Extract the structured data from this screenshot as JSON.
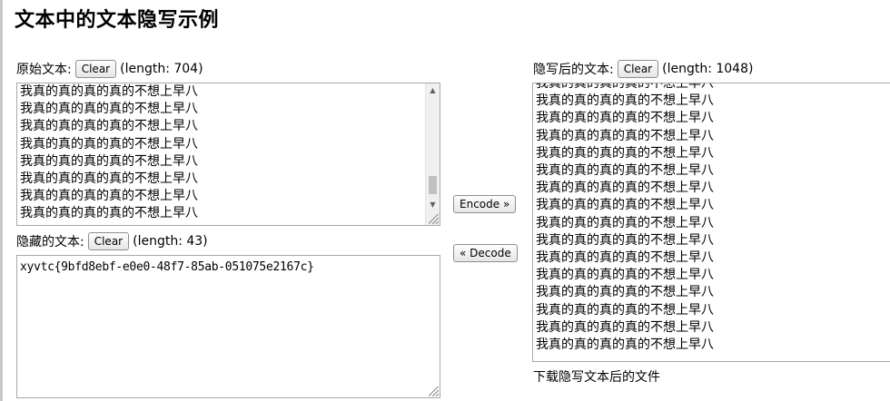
{
  "page": {
    "title": "文本中的文本隐写示例"
  },
  "original": {
    "label": "原始文本:",
    "clear_label": "Clear",
    "length_text": "(length: 704)",
    "lines": [
      "我真的真的真的真的不想上早八",
      "我真的真的真的真的不想上早八",
      "我真的真的真的真的不想上早八",
      "我真的真的真的真的不想上早八",
      "我真的真的真的真的不想上早八",
      "我真的真的真的真的不想上早八",
      "我真的真的真的真的不想上早八",
      "我真的真的真的真的不想上早八"
    ]
  },
  "hidden": {
    "label": "隐藏的文本:",
    "clear_label": "Clear",
    "length_text": "(length: 43)",
    "value": "xyvtc{9bfd8ebf-e0e0-48f7-85ab-051075e2167c}"
  },
  "actions": {
    "encode_label": "Encode »",
    "decode_label": "« Decode"
  },
  "stego": {
    "label": "隐写后的文本:",
    "clear_label": "Clear",
    "length_text": "(length: 1048)",
    "lines": [
      "我真的真的真的真的不想上早八",
      "我真的真的真的真的不想上早八",
      "我真的真的真的真的不想上早八",
      "我真的真的真的真的不想上早八",
      "我真的真的真的真的不想上早八",
      "我真的真的真的真的不想上早八",
      "我真的真的真的真的不想上早八",
      "我真的真的真的真的不想上早八",
      "我真的真的真的真的不想上早八",
      "我真的真的真的真的不想上早八",
      "我真的真的真的真的不想上早八",
      "我真的真的真的真的不想上早八",
      "我真的真的真的真的不想上早八",
      "我真的真的真的真的不想上早八",
      "我真的真的真的真的不想上早八",
      "我真的真的真的真的不想上早八"
    ],
    "download_label": "下载隐写文本后的文件"
  }
}
